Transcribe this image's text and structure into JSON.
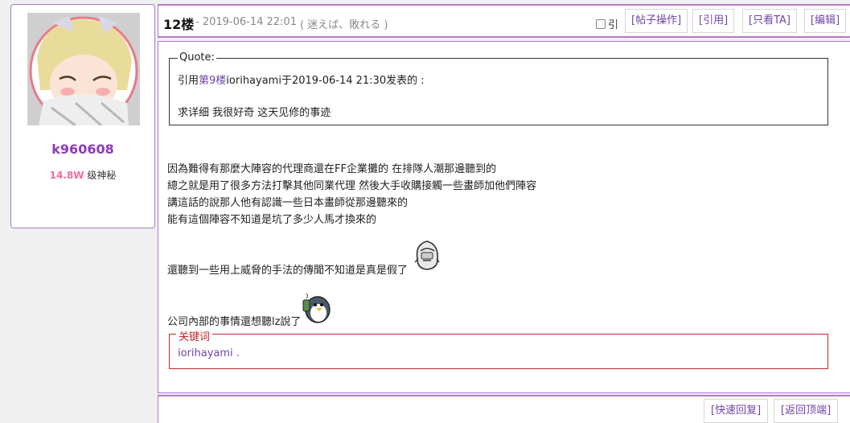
{
  "user": {
    "name": "k960608",
    "level_value": "14.8W",
    "level_label": " 级神秘"
  },
  "header": {
    "floor": "12楼",
    "time": "- 2019-06-14 22:01",
    "subtitle": "( 迷えば、敗れる )",
    "quote_check_label": "引",
    "buttons": [
      "[帖子操作]",
      "[引用]",
      "[只看TA]",
      "[编辑]"
    ]
  },
  "quote": {
    "title": "Quote:",
    "prefix": "引用",
    "floor_link": "第9楼",
    "suffix": "iorihayami于2019-06-14 21:30发表的 :",
    "text": "求详细 我很好奇 这天见修的事迹"
  },
  "body": {
    "paragraphs": [
      "因為難得有那麼大陣容的代理商還在FF企業攤的 在排隊人潮那邊聽到的",
      "總之就是用了很多方法打擊其他同業代理 然後大手收購接觸一些畫師加他們陣容",
      "講這話的說那人他有認識一些日本畫師從那邊聽來的",
      "能有這個陣容不知道是坑了多少人馬才換來的"
    ],
    "line5": "還聽到一些用上威脅的手法的傳聞不知道是真是假了",
    "line6": "公司內部的事情還想聽lz說了"
  },
  "keyword": {
    "title": "关键词",
    "value": "iorihayami ."
  },
  "footer": {
    "quick_reply": "[快速回复]",
    "back_top": "[返回顶端]"
  },
  "colors": {
    "accent": "#b47ac8",
    "link": "#7044a8",
    "username": "#8d39b8",
    "level": "#f06ba0",
    "keyword_border": "#c0282d"
  },
  "icons": {
    "avatar": "anime-girl-avatar",
    "sticker1": "penguin-sticker",
    "sticker2": "penguin-drinking-sticker"
  }
}
